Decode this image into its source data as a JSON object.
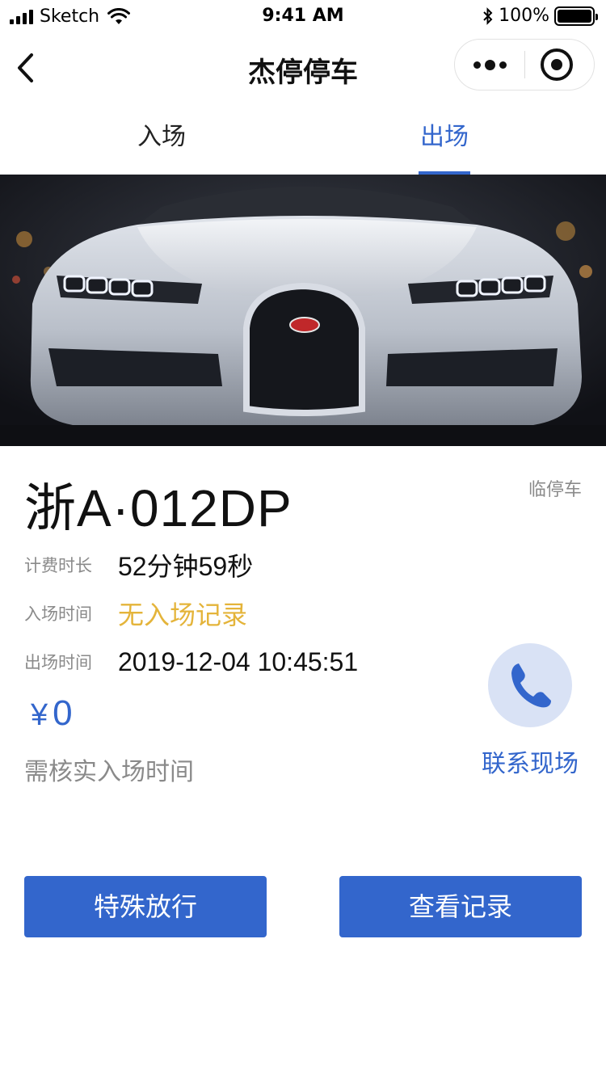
{
  "status_bar": {
    "carrier": "Sketch",
    "time": "9:41 AM",
    "battery": "100%"
  },
  "nav": {
    "title": "杰停停车"
  },
  "tabs": [
    {
      "label": "入场",
      "active": false
    },
    {
      "label": "出场",
      "active": true
    }
  ],
  "vehicle": {
    "plate": "浙A·012DP",
    "type": "临停车"
  },
  "details": {
    "duration_label": "计费时长",
    "duration_value": "52分钟59秒",
    "entry_label": "入场时间",
    "entry_value": "无入场记录",
    "exit_label": "出场时间",
    "exit_value": "2019-12-04 10:45:51"
  },
  "fee": {
    "currency": "¥",
    "amount": "0",
    "note": "需核实入场时间"
  },
  "contact": {
    "label": "联系现场",
    "icon": "phone-icon"
  },
  "actions": {
    "special_release": "特殊放行",
    "view_records": "查看记录"
  },
  "colors": {
    "accent": "#3366cc",
    "warning": "#e4b43a",
    "muted": "#8a8a8a",
    "contact_bg": "#d9e2f5"
  }
}
